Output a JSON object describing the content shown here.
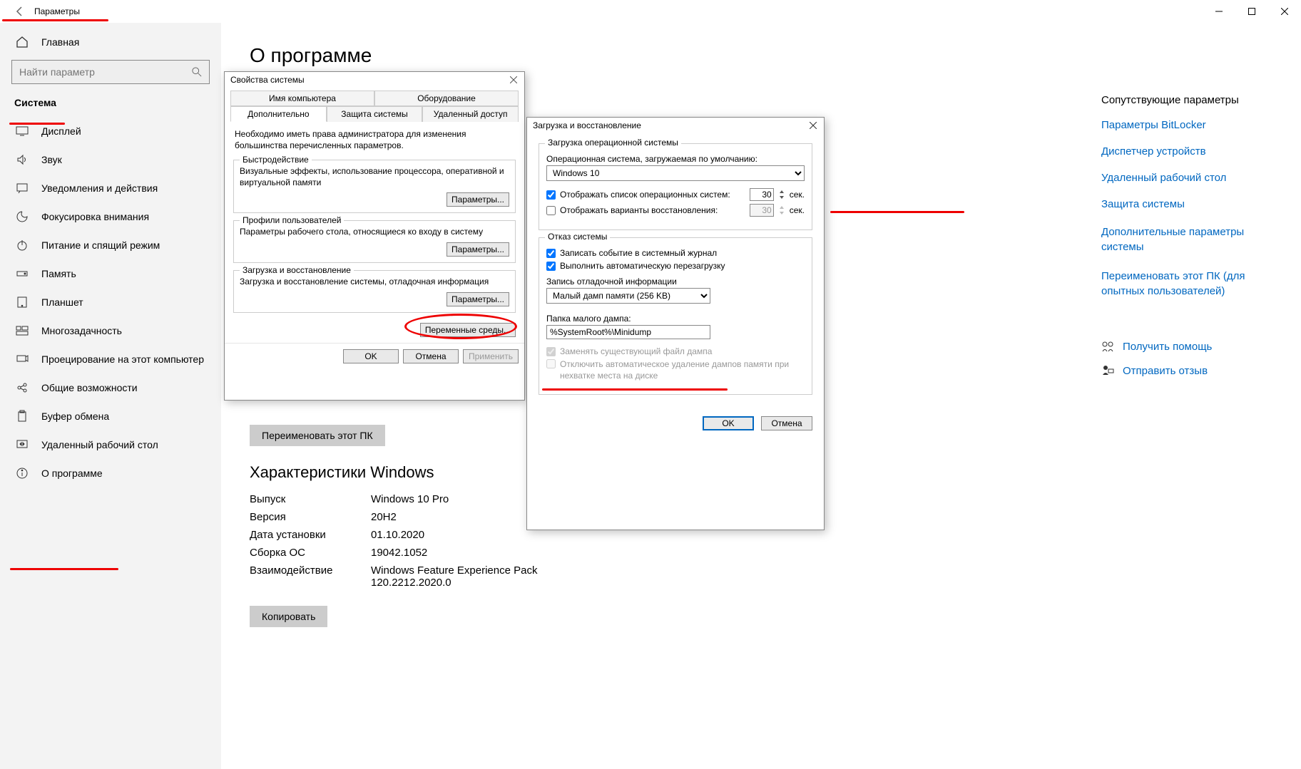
{
  "titlebar": {
    "title": "Параметры"
  },
  "sidebar": {
    "home": "Главная",
    "search_placeholder": "Найти параметр",
    "system_header": "Система",
    "items": [
      {
        "label": "Дисплей"
      },
      {
        "label": "Звук"
      },
      {
        "label": "Уведомления и действия"
      },
      {
        "label": "Фокусировка внимания"
      },
      {
        "label": "Питание и спящий режим"
      },
      {
        "label": "Память"
      },
      {
        "label": "Планшет"
      },
      {
        "label": "Многозадачность"
      },
      {
        "label": "Проецирование на этот компьютер"
      },
      {
        "label": "Общие возможности"
      },
      {
        "label": "Буфер обмена"
      },
      {
        "label": "Удаленный рабочий стол"
      },
      {
        "label": "О программе"
      }
    ]
  },
  "main": {
    "page_title": "О программе",
    "rename_btn": "Переименовать этот ПК",
    "specs_title": "Характеристики Windows",
    "specs": [
      {
        "label": "Выпуск",
        "value": "Windows 10 Pro"
      },
      {
        "label": "Версия",
        "value": "20H2"
      },
      {
        "label": "Дата установки",
        "value": "01.10.2020"
      },
      {
        "label": "Сборка ОС",
        "value": "19042.1052"
      },
      {
        "label": "Взаимодействие",
        "value": "Windows Feature Experience Pack 120.2212.2020.0"
      }
    ],
    "copy_btn": "Копировать"
  },
  "related": {
    "title": "Сопутствующие параметры",
    "links": [
      "Параметры BitLocker",
      "Диспетчер устройств",
      "Удаленный рабочий стол",
      "Защита системы",
      "Дополнительные параметры системы",
      "Переименовать этот ПК (для опытных пользователей)"
    ],
    "help": "Получить помощь",
    "feedback": "Отправить отзыв"
  },
  "dlg1": {
    "title": "Свойства системы",
    "tabs_top": [
      "Имя компьютера",
      "Оборудование"
    ],
    "tabs_bottom": [
      "Дополнительно",
      "Защита системы",
      "Удаленный доступ"
    ],
    "admin_note": "Необходимо иметь права администратора для изменения большинства перечисленных параметров.",
    "fs1": {
      "legend": "Быстродействие",
      "text": "Визуальные эффекты, использование процессора, оперативной и виртуальной памяти",
      "btn": "Параметры..."
    },
    "fs2": {
      "legend": "Профили пользователей",
      "text": "Параметры рабочего стола, относящиеся ко входу в систему",
      "btn": "Параметры..."
    },
    "fs3": {
      "legend": "Загрузка и восстановление",
      "text": "Загрузка и восстановление системы, отладочная информация",
      "btn": "Параметры..."
    },
    "env_btn": "Переменные среды...",
    "ok": "OK",
    "cancel": "Отмена",
    "apply": "Применить"
  },
  "dlg2": {
    "title": "Загрузка и восстановление",
    "group1_title": "Загрузка операционной системы",
    "os_label": "Операционная система, загружаемая по умолчанию:",
    "os_value": "Windows 10",
    "show_list": "Отображать список операционных систем:",
    "show_list_val": "30",
    "show_recovery": "Отображать варианты восстановления:",
    "show_recovery_val": "30",
    "sec": "сек.",
    "group2_title": "Отказ системы",
    "write_event": "Записать событие в системный журнал",
    "auto_restart": "Выполнить автоматическую перезагрузку",
    "debug_label": "Запись отладочной информации",
    "debug_value": "Малый дамп памяти (256 KB)",
    "dump_folder_label": "Папка малого дампа:",
    "dump_folder_value": "%SystemRoot%\\Minidump",
    "replace_dump": "Заменять существующий файл дампа",
    "disable_autodelete": "Отключить автоматическое удаление дампов памяти при нехватке места на диске",
    "ok": "OK",
    "cancel": "Отмена"
  }
}
